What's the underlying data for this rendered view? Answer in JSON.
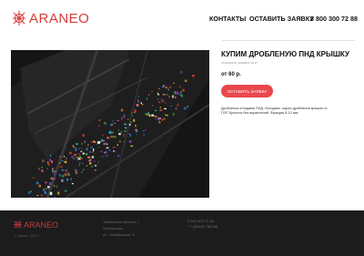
{
  "header": {
    "logo_text": "ARANEO",
    "nav": {
      "contacts": "КОНТАКТЫ",
      "request": "ОСТАВИТЬ ЗАЯВКУ",
      "phone": "8 800 300 72 88"
    }
  },
  "product": {
    "title": "КУПИМ ДРОБЛЕНУЮ ПНД КРЫШКУ",
    "subtitle": "стоимость указана за кг",
    "price": "от 60 р.",
    "button_label": "ОСТАВИТЬ ЗАЯВКУ",
    "description_line1": "Дробленка отходами ПНД. Исходник: сырье дробления крышек от",
    "description_line2": "ПЭТ бутылок без вкраплений. Фракция 8-12 мм."
  },
  "footer": {
    "logo_text": "ARANEO",
    "copyright": "© Araneo, 2021 г.",
    "address_line1": "Тюменская область, г.",
    "address_line2": "Ялуторовск,",
    "address_line3": "ул. Октябрьская, 3",
    "phone1": "8 800 300 72 88",
    "phone2": "+7 (34542) 369 88"
  },
  "colors": {
    "accent": "#e8474c",
    "footer_bg": "#1c1c1c"
  }
}
